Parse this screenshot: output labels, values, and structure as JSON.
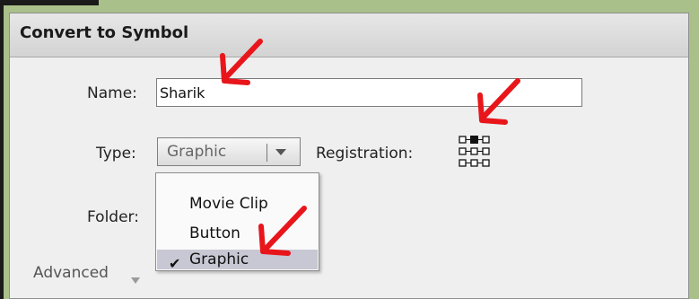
{
  "dialog": {
    "title": "Convert to Symbol",
    "name_label": "Name:",
    "name_value": "Sharik",
    "type_label": "Type:",
    "type_value": "Graphic",
    "registration_label": "Registration:",
    "folder_label": "Folder:",
    "advanced_label": "Advanced"
  },
  "type_menu": {
    "options": [
      {
        "label": "Movie Clip",
        "selected": false
      },
      {
        "label": "Button",
        "selected": false
      },
      {
        "label": "Graphic",
        "selected": true
      }
    ]
  },
  "registration": {
    "selected": "top-center"
  },
  "colors": {
    "background": "#a9c08a",
    "dialog": "#efefef",
    "annotation_arrow": "#e8161b",
    "menu_highlight": "#c8c8d4"
  },
  "icons": [
    "check-icon",
    "chevron-down-icon",
    "registration-grid-icon",
    "annotation-arrow-icon"
  ]
}
